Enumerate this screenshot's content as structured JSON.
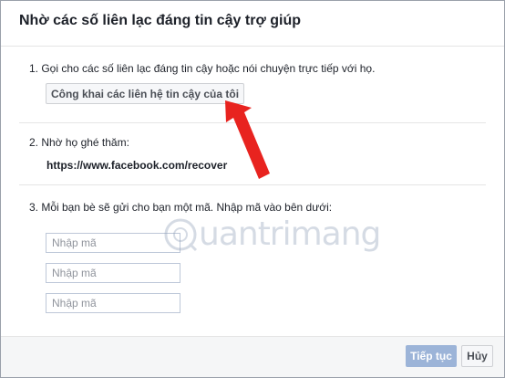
{
  "dialog": {
    "title": "Nhờ các số liên lạc đáng tin cậy trợ giúp",
    "steps": [
      {
        "text": "1. Gọi cho các số liên lạc đáng tin cậy hoặc nói chuyện trực tiếp với họ."
      },
      {
        "text": "2. Nhờ họ ghé thăm:"
      },
      {
        "text": "3. Mỗi bạn bè sẽ gửi cho bạn một mã. Nhập mã vào bên dưới:"
      }
    ],
    "public_button_label": "Công khai các liên hệ tin cậy của tôi",
    "recover_url": "https://www.facebook.com/recover",
    "code_inputs": [
      {
        "placeholder": "Nhập mã",
        "value": ""
      },
      {
        "placeholder": "Nhập mã",
        "value": ""
      },
      {
        "placeholder": "Nhập mã",
        "value": ""
      }
    ],
    "footer": {
      "continue_label": "Tiếp tục",
      "cancel_label": "Hủy"
    }
  },
  "annotation": {
    "arrow_color": "#e8231f"
  },
  "watermark": {
    "logo_label": "Quantrimang"
  }
}
